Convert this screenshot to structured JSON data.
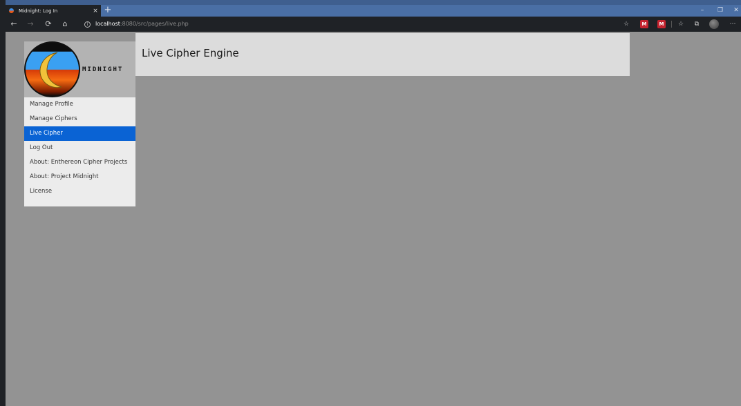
{
  "browser": {
    "tab_title": "Midnight: Log In",
    "tab_close": "×",
    "new_tab": "+",
    "window_controls": {
      "minimize": "–",
      "restore": "❐",
      "close": "✕"
    },
    "nav": {
      "back": "←",
      "forward": "→",
      "refresh": "⟳",
      "home": "⌂"
    },
    "url": {
      "host": "localhost",
      "rest": ":8080/src/pages/live.php"
    },
    "toolbar": {
      "favorite": "☆",
      "ext1": "M",
      "ext2": "M",
      "favorites": "☆",
      "collections": "⧉",
      "more": "⋯"
    },
    "colors": {
      "tabbar": "#4a6fa5",
      "chrome_dark": "#1f2226"
    }
  },
  "sidebar": {
    "logo_text": "MIDNIGHT",
    "items": [
      {
        "label": "Manage Profile",
        "active": false
      },
      {
        "label": "Manage Ciphers",
        "active": false
      },
      {
        "label": "Live Cipher",
        "active": true
      },
      {
        "label": "Log Out",
        "active": false
      },
      {
        "label": "About: Enthereon Cipher Projects",
        "active": false
      },
      {
        "label": "About: Project Midnight",
        "active": false
      },
      {
        "label": "License",
        "active": false
      }
    ]
  },
  "header": {
    "title": "Live Cipher Engine"
  },
  "colors": {
    "page_bg": "#939393",
    "active_item": "#0a63d4",
    "header_bg": "#dcdcdc",
    "sidebar_bg": "#ececec"
  }
}
